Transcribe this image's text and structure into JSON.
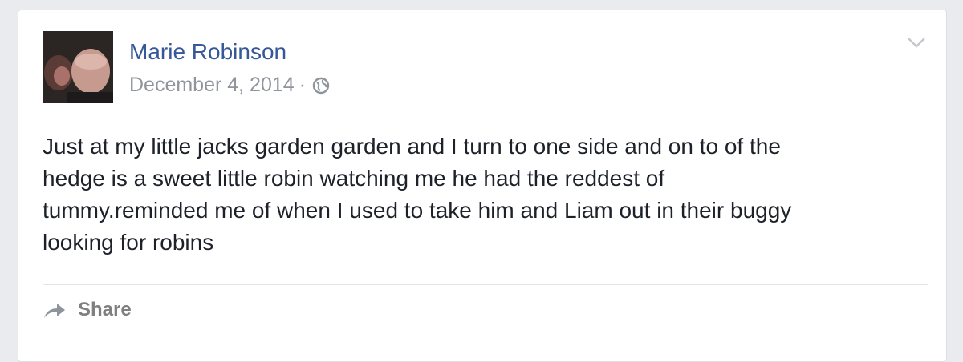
{
  "post": {
    "author": "Marie Robinson",
    "date": "December 4, 2014",
    "separator": "·",
    "privacy_icon": "globe-icon",
    "menu_icon": "chevron-down-icon",
    "avatar_icon": "profile-photo",
    "text_lines": [
      "Just at my little jacks garden garden and I turn to one side and on to of the",
      "hedge is a sweet little robin watching me he had the reddest of",
      "tummy.reminded me of when I used to take him and Liam out in their buggy",
      "looking for robins"
    ]
  },
  "actions": {
    "share_label": "Share",
    "share_icon": "share-arrow-icon"
  },
  "colors": {
    "author_link": "#365899",
    "meta_text": "#90949c",
    "body_text": "#1d2129",
    "page_background": "#e9ebee"
  }
}
